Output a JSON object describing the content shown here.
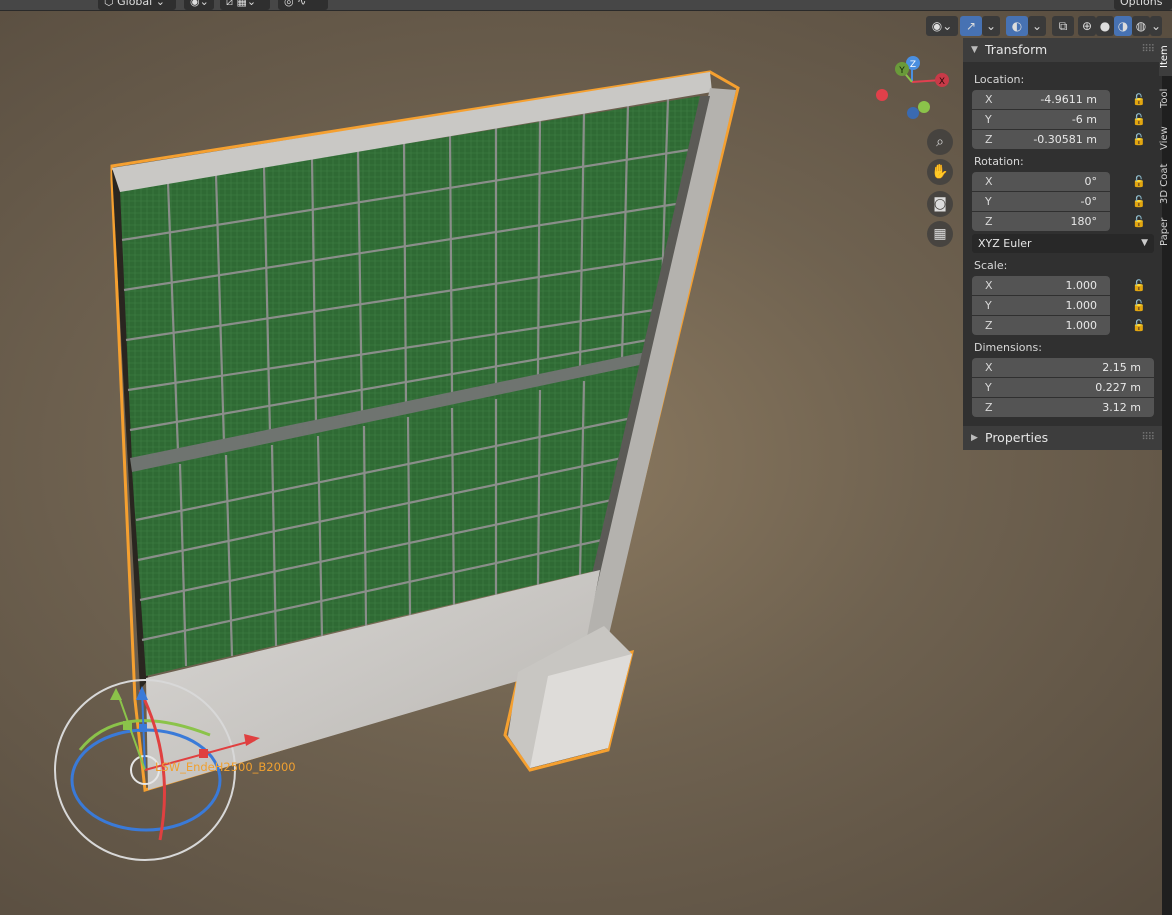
{
  "header": {
    "orientation_label": "Global",
    "options_label": "Options"
  },
  "viewport": {
    "object_name": "LSW_EndeH2500_B2000",
    "gizmo_axes": {
      "x": "X",
      "y": "Y",
      "z": "Z"
    },
    "accent_color": "#f5a030",
    "panel_color": "#2e6b32"
  },
  "transform": {
    "title": "Transform",
    "location_label": "Location:",
    "location": [
      {
        "axis": "X",
        "value": "-4.9611 m"
      },
      {
        "axis": "Y",
        "value": "-6 m"
      },
      {
        "axis": "Z",
        "value": "-0.30581 m"
      }
    ],
    "rotation_label": "Rotation:",
    "rotation": [
      {
        "axis": "X",
        "value": "0°"
      },
      {
        "axis": "Y",
        "value": "-0°"
      },
      {
        "axis": "Z",
        "value": "180°"
      }
    ],
    "rotation_mode": "XYZ Euler",
    "scale_label": "Scale:",
    "scale": [
      {
        "axis": "X",
        "value": "1.000"
      },
      {
        "axis": "Y",
        "value": "1.000"
      },
      {
        "axis": "Z",
        "value": "1.000"
      }
    ],
    "dimensions_label": "Dimensions:",
    "dimensions": [
      {
        "axis": "X",
        "value": "2.15 m"
      },
      {
        "axis": "Y",
        "value": "0.227 m"
      },
      {
        "axis": "Z",
        "value": "3.12 m"
      }
    ]
  },
  "properties_title": "Properties",
  "sidebar_tabs": [
    "Item",
    "Tool",
    "View",
    "3D Coat",
    "Paper"
  ]
}
